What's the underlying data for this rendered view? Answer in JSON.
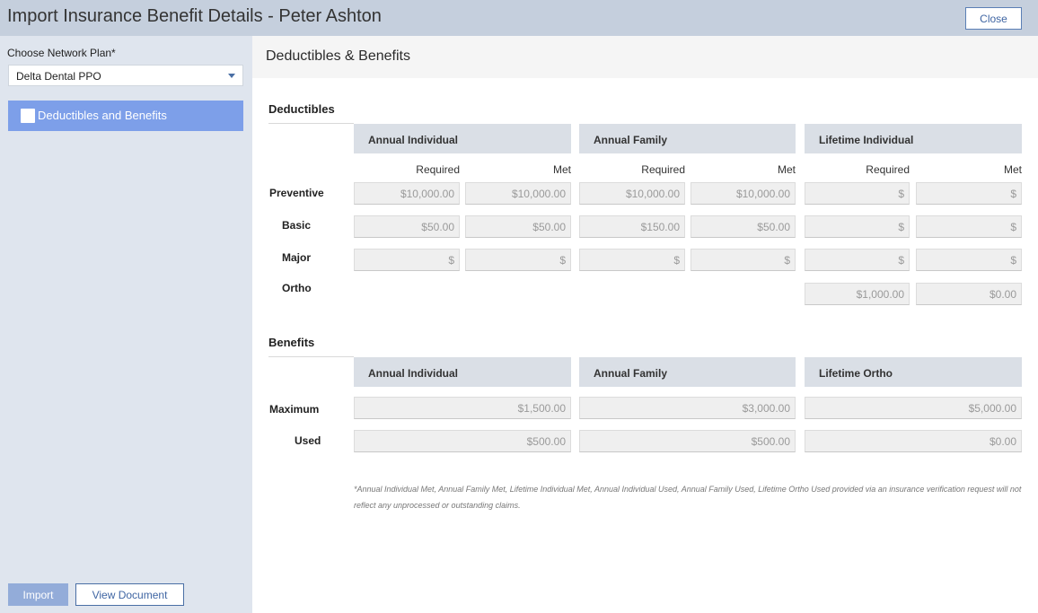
{
  "window": {
    "title": "Import Insurance Benefit Details - Peter Ashton",
    "close_label": "Close"
  },
  "sidebar": {
    "plan_label": "Choose Network Plan*",
    "plan_value": "Delta Dental PPO",
    "items": [
      {
        "label": "Deductibles and Benefits",
        "selected": true
      }
    ],
    "import_label": "Import",
    "view_document_label": "View Document"
  },
  "main": {
    "title": "Deductibles & Benefits",
    "deductibles": {
      "title": "Deductibles",
      "columns": [
        "Annual Individual",
        "Annual Family",
        "Lifetime Individual"
      ],
      "required_label": "Required",
      "met_label": "Met",
      "rows": [
        {
          "label": "Preventive",
          "values": [
            "$10,000.00",
            "$10,000.00",
            "$10,000.00",
            "$10,000.00",
            "$",
            "$"
          ]
        },
        {
          "label": "Basic",
          "values": [
            "$50.00",
            "$50.00",
            "$150.00",
            "$50.00",
            "$",
            "$"
          ]
        },
        {
          "label": "Major",
          "values": [
            "$",
            "$",
            "$",
            "$",
            "$",
            "$"
          ]
        },
        {
          "label": "Ortho",
          "values": [
            "$1,000.00",
            "$0.00"
          ]
        }
      ]
    },
    "benefits": {
      "title": "Benefits",
      "columns": [
        "Annual Individual",
        "Annual Family",
        "Lifetime Ortho"
      ],
      "rows": [
        {
          "label": "Maximum",
          "values": [
            "$1,500.00",
            "$3,000.00",
            "$5,000.00"
          ]
        },
        {
          "label": "Used",
          "values": [
            "$500.00",
            "$500.00",
            "$0.00"
          ]
        }
      ]
    },
    "footnote": "*Annual Individual Met, Annual Family Met, Lifetime Individual Met, Annual Individual Used, Annual Family Used, Lifetime Ortho Used provided via an insurance verification request will not reflect any unprocessed or outstanding claims."
  },
  "colors": {
    "header_bg": "#c5cfdd",
    "sidebar_bg": "#dfe5ee",
    "nav_selected": "#7d9fe9",
    "accent": "#3f65a3"
  }
}
